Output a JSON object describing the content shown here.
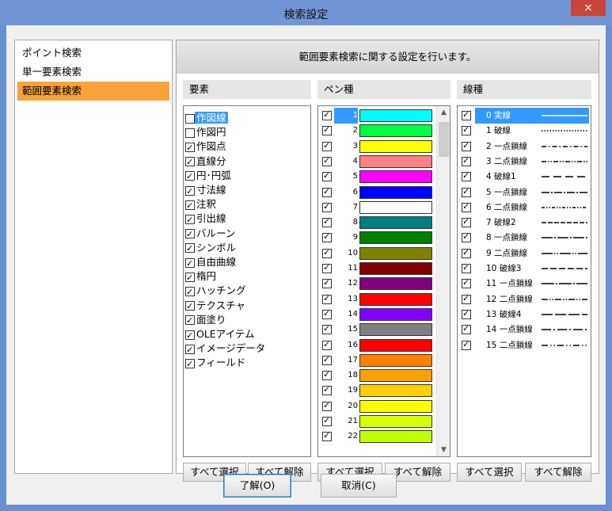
{
  "window": {
    "title": "検索設定",
    "close_label": "×"
  },
  "nav": {
    "items": [
      "ポイント検索",
      "単一要素検索",
      "範囲要素検索"
    ],
    "selected_index": 2
  },
  "header": {
    "text": "範囲要素検索に関する設定を行います。"
  },
  "columns": {
    "elements": "要素",
    "pen": "ペン種",
    "line": "線種"
  },
  "elements": [
    {
      "label": "作図線",
      "checked": false,
      "selected": true
    },
    {
      "label": "作図円",
      "checked": false
    },
    {
      "label": "作図点",
      "checked": true
    },
    {
      "label": "直線分",
      "checked": true
    },
    {
      "label": "円･円弧",
      "checked": true
    },
    {
      "label": "寸法線",
      "checked": true
    },
    {
      "label": "注釈",
      "checked": true
    },
    {
      "label": "引出線",
      "checked": true
    },
    {
      "label": "バルーン",
      "checked": true
    },
    {
      "label": "シンボル",
      "checked": true
    },
    {
      "label": "自由曲線",
      "checked": true
    },
    {
      "label": "楕円",
      "checked": true
    },
    {
      "label": "ハッチング",
      "checked": true
    },
    {
      "label": "テクスチャ",
      "checked": true
    },
    {
      "label": "面塗り",
      "checked": true
    },
    {
      "label": "OLEアイテム",
      "checked": true
    },
    {
      "label": "イメージデータ",
      "checked": true
    },
    {
      "label": "フィールド",
      "checked": true
    }
  ],
  "pens": [
    {
      "num": "1",
      "color": "#00ffff",
      "selected": true
    },
    {
      "num": "2",
      "color": "#00ff40"
    },
    {
      "num": "3",
      "color": "#ffff00"
    },
    {
      "num": "4",
      "color": "#ff8080"
    },
    {
      "num": "5",
      "color": "#ff00ff"
    },
    {
      "num": "6",
      "color": "#0000ff"
    },
    {
      "num": "7",
      "color": "#ffffff"
    },
    {
      "num": "8",
      "color": "#008080"
    },
    {
      "num": "9",
      "color": "#008000"
    },
    {
      "num": "10",
      "color": "#808000"
    },
    {
      "num": "11",
      "color": "#800000"
    },
    {
      "num": "12",
      "color": "#800080"
    },
    {
      "num": "13",
      "color": "#ff0000"
    },
    {
      "num": "14",
      "color": "#8000ff"
    },
    {
      "num": "15",
      "color": "#808080"
    },
    {
      "num": "16",
      "color": "#ff0000"
    },
    {
      "num": "17",
      "color": "#ff8000"
    },
    {
      "num": "18",
      "color": "#ffa000"
    },
    {
      "num": "19",
      "color": "#ffd000"
    },
    {
      "num": "20",
      "color": "#ffff00"
    },
    {
      "num": "21",
      "color": "#d8ff00"
    },
    {
      "num": "22",
      "color": "#c0ff00"
    }
  ],
  "lines": [
    {
      "label": "0 実線",
      "selected": true,
      "dash": ""
    },
    {
      "label": "1 破線",
      "dash": "1.5,2"
    },
    {
      "label": "2 一点鎖線",
      "dash": "6,3,1.5,3"
    },
    {
      "label": "3 二点鎖線",
      "dash": "6,2,1.5,2,1.5,2"
    },
    {
      "label": "4 破線1",
      "dash": "10,5"
    },
    {
      "label": "5 一点鎖線",
      "dash": "10,2,2,2"
    },
    {
      "label": "6 二点鎖線",
      "dash": "4,2,1.5,2,1.5,2"
    },
    {
      "label": "7 破線2",
      "dash": "6,2"
    },
    {
      "label": "8 一点鎖線",
      "dash": "14,2,2,2"
    },
    {
      "label": "9 二点鎖線",
      "dash": "14,2,1.5,2,1.5,2"
    },
    {
      "label": "10 破線3",
      "dash": "8,3"
    },
    {
      "label": "11 一点鎖線",
      "dash": "16,2,2,2"
    },
    {
      "label": "12 二点鎖線",
      "dash": "8,2,1.5,2,1.5,2"
    },
    {
      "label": "13 破線4",
      "dash": "14,3"
    },
    {
      "label": "14 一点鎖線",
      "dash": "12,3,2,3"
    },
    {
      "label": "15 二点鎖線",
      "dash": "8,3,1.5,3,1.5,3"
    }
  ],
  "buttons": {
    "select_all": "すべて選択",
    "deselect_all": "すべて解除",
    "ok": "了解(O)",
    "cancel": "取消(C)"
  },
  "scroll": {
    "up": "▲",
    "down": "▼"
  }
}
